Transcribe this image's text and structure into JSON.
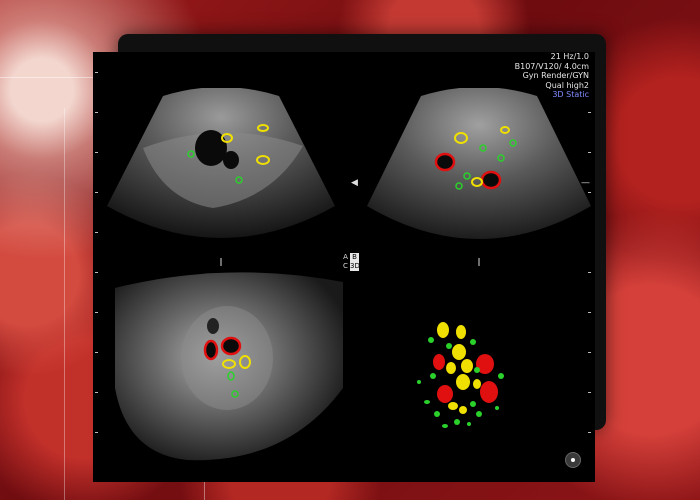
{
  "overlay": {
    "line1": "21 Hz/1.0",
    "line2": "B107/V120/ 4.0cm",
    "line3": "Gyn Render/GYN",
    "line4": "Qual high2",
    "line5": "3D Static"
  },
  "plane_labels": {
    "a": "A",
    "b": "B",
    "c": "C",
    "d": "3D"
  },
  "colors": {
    "follicle_small": "#2bd12b",
    "follicle_medium": "#f0e000",
    "follicle_large": "#e01010",
    "background_blood": "#8e1517",
    "screen": "#000000",
    "overlay_static": "#7f8cff"
  },
  "icons": {
    "corner_marker": "orientation-dot-icon",
    "side_marker": "arrow-marker-icon"
  }
}
